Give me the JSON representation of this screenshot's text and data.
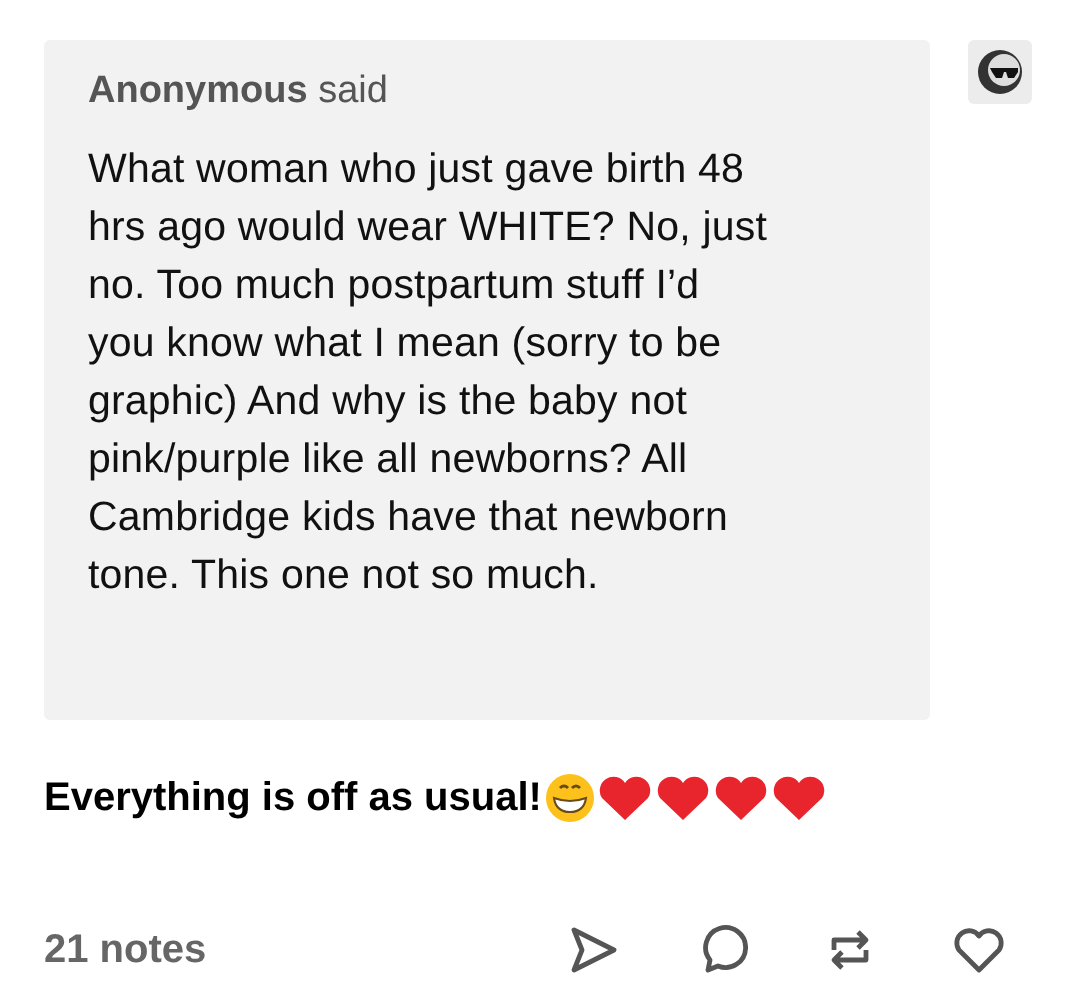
{
  "ask": {
    "asker": "Anonymous",
    "verb": "said",
    "lines": [
      "What woman who just gave birth 48",
      "hrs ago would wear WHITE? No, just",
      "no. Too much postpartum stuff I’d",
      "you know what I mean (sorry to be",
      "graphic) And why is the baby not",
      "pink/purple like all newborns? All",
      "Cambridge kids have that newborn",
      "tone. This one not so much."
    ]
  },
  "answer": "Everything is off as usual!",
  "footer": {
    "notes": "21 notes"
  }
}
